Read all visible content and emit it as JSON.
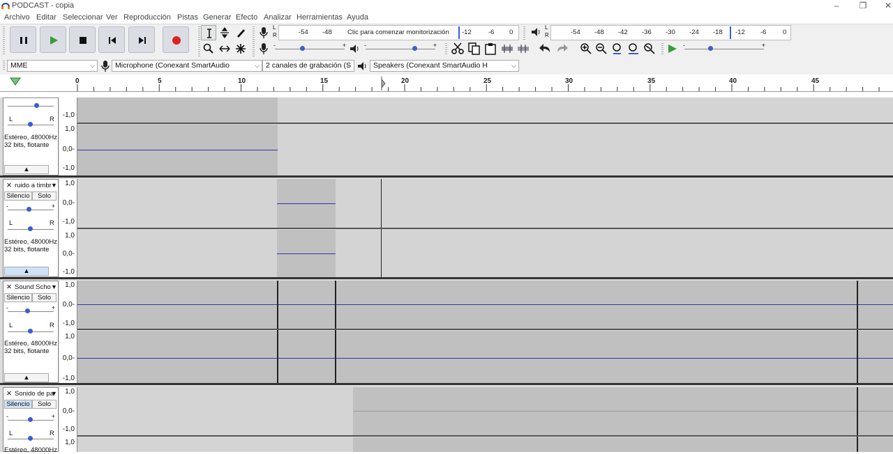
{
  "window": {
    "title": "PODCAST - copia",
    "min": "–",
    "restore": "❐",
    "close": "✕"
  },
  "menu": [
    "Archivo",
    "Editar",
    "Seleccionar",
    "Ver",
    "Reproducción",
    "Pistas",
    "Generar",
    "Efecto",
    "Analizar",
    "Herramientas",
    "Ayuda"
  ],
  "recording_meter": {
    "scale": [
      "-54",
      "-48"
    ],
    "prompt": "Clic para comenzar monitorización",
    "scale2": [
      "-12",
      "-6",
      "0"
    ]
  },
  "playback_meter": {
    "scale": [
      "-54",
      "-48",
      "-42",
      "-36",
      "-30",
      "-24",
      "-18",
      "-12",
      "-6",
      "0"
    ]
  },
  "meter_lr": {
    "l": "L",
    "r": "R"
  },
  "slider_marks": {
    "minus": "-",
    "plus": "+"
  },
  "devices": {
    "host": "MME",
    "mic": "Microphone (Conexant SmartAudio",
    "channels": "2 canales de grabación (S",
    "speakers": "Speakers (Conexant SmartAudio H"
  },
  "ruler": [
    "0",
    "5",
    "10",
    "15",
    "20",
    "25",
    "30",
    "35",
    "40",
    "45"
  ],
  "scale_labels": {
    "top": "1,0",
    "mid": "0,0-",
    "bot": "-1,0",
    "bot_first": "-1,0"
  },
  "panel_common": {
    "info1": "Estéreo, 48000Hz",
    "info2": "32 bits, flotante",
    "mute": "Silencio",
    "solo": "Solo",
    "close": "✕",
    "menu_arrow": "▼",
    "collapse": "▲",
    "pan_l": "L",
    "pan_r": "R",
    "g_minus": "-",
    "g_plus": "+"
  },
  "tracks": [
    {
      "name": ""
    },
    {
      "name": "ruido a timbr"
    },
    {
      "name": "Sound Scho"
    },
    {
      "name": "Sonido de pa"
    }
  ],
  "colors": {
    "clip": "#c0c0c0",
    "lane": "#d4d4d4",
    "wave": "#3333aa",
    "selected_panel": "#cfe2f7"
  }
}
